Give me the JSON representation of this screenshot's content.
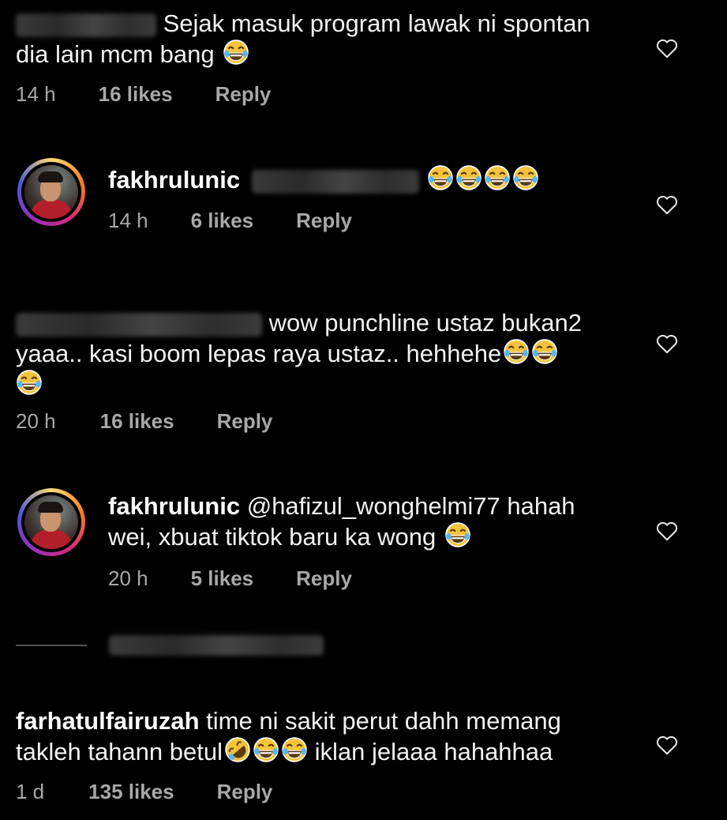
{
  "comments": [
    {
      "text_line1": "Sejak masuk program lawak ni spontan",
      "text_line2": "dia lain mcm bang",
      "time": "14 h",
      "likes": "16 likes",
      "reply": "Reply"
    },
    {
      "username": "fakhrulunic",
      "time": "14 h",
      "likes": "6 likes",
      "reply": "Reply"
    },
    {
      "text_line1": "wow punchline ustaz bukan2",
      "text_line2": "yaaa.. kasi boom lepas raya ustaz.. hehhehe",
      "time": "20 h",
      "likes": "16 likes",
      "reply": "Reply"
    },
    {
      "username": "fakhrulunic",
      "mention": "@hafizul_wonghelmi77",
      "text_line1_rest": "hahah",
      "text_line2": "wei, xbuat tiktok baru ka wong",
      "time": "20 h",
      "likes": "5 likes",
      "reply": "Reply"
    },
    {
      "username": "farhatulfairuzah",
      "text_line1": "time ni sakit perut dahh memang",
      "text_line2": "takleh tahann betul",
      "text_line2_rest": "iklan jelaaa hahahhaa",
      "time": "1 d",
      "likes": "135 likes",
      "reply": "Reply"
    }
  ],
  "icons": {
    "like": "heart-outline-icon",
    "emoji": "face-with-tears-of-joy",
    "emoji_alt": "rolling-on-floor-laughing"
  },
  "colors": {
    "background": "#000000",
    "text": "#f2f2f2",
    "meta": "#a8a8a8",
    "story_ring": [
      "#feda75",
      "#fa7e1e",
      "#d62976",
      "#962fbf",
      "#4f5bd5"
    ]
  }
}
